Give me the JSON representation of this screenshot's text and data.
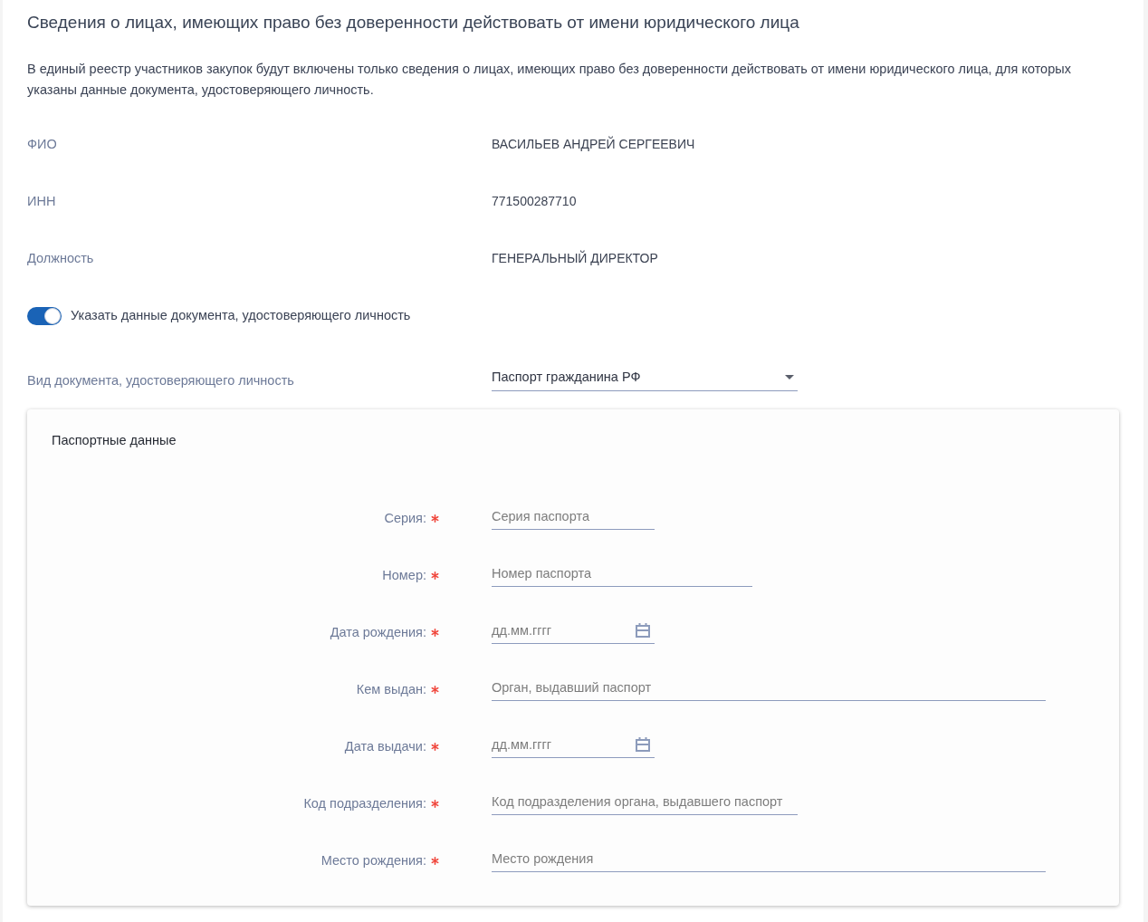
{
  "title": "Сведения о лицах, имеющих право без доверенности действовать от имени юридического лица",
  "description": "В единый реестр участников закупок будут включены только сведения о лицах, имеющих право без доверенности действовать от имени юридического лица, для которых указаны данные документа, удостоверяющего личность.",
  "details": [
    {
      "label": "ФИО",
      "value": "ВАСИЛЬЕВ АНДРЕЙ СЕРГЕЕВИЧ"
    },
    {
      "label": "ИНН",
      "value": "771500287710"
    },
    {
      "label": "Должность",
      "value": "ГЕНЕРАЛЬНЫЙ ДИРЕКТОР"
    }
  ],
  "identity_toggle": {
    "label": "Указать данные документа, удостоверяющего личность",
    "on": true
  },
  "document_type": {
    "label": "Вид документа, удостоверяющего личность",
    "value": "Паспорт гражданина РФ"
  },
  "passport": {
    "title": "Паспортные данные",
    "fields": [
      {
        "kind": "text",
        "label": "Серия:",
        "placeholder": "Серия паспорта",
        "required": true
      },
      {
        "kind": "text",
        "label": "Номер:",
        "placeholder": "Номер паспорта",
        "required": true
      },
      {
        "kind": "date",
        "label": "Дата рождения:",
        "placeholder": "дд.мм.гггг",
        "required": true
      },
      {
        "kind": "text",
        "label": "Кем выдан:",
        "placeholder": "Орган, выдавший паспорт",
        "required": true
      },
      {
        "kind": "date",
        "label": "Дата выдачи:",
        "placeholder": "дд.мм.гггг",
        "required": true
      },
      {
        "kind": "text",
        "label": "Код подразделения:",
        "placeholder": "Код подразделения органа, выдавшего паспорт",
        "required": true
      },
      {
        "kind": "text",
        "label": "Место рождения:",
        "placeholder": "Место рождения",
        "required": true
      }
    ]
  }
}
